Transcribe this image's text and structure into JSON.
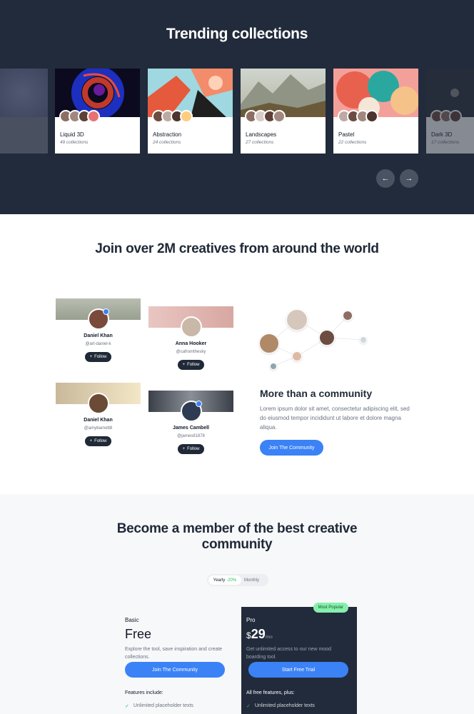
{
  "trending": {
    "title": "Trending collections",
    "collections": [
      {
        "name": "Liquid 3D",
        "count": "49 collections"
      },
      {
        "name": "Abstraction",
        "count": "24 collections"
      },
      {
        "name": "Landscapes",
        "count": "27 collections"
      },
      {
        "name": "Pastel",
        "count": "22 collections"
      },
      {
        "name": "Dark 3D",
        "count": "17 collections"
      }
    ],
    "prev_icon": "arrow-left-icon",
    "next_icon": "arrow-right-icon"
  },
  "community": {
    "title": "Join over 2M creatives from around the world",
    "users": [
      {
        "name": "Daniel Khan",
        "handle": "@art-daniel-k",
        "follow": "Follow"
      },
      {
        "name": "Anna Hooker",
        "handle": "@cafromthesky",
        "follow": "Follow"
      },
      {
        "name": "Daniel Khan",
        "handle": "@amybarnett8",
        "follow": "Follow"
      },
      {
        "name": "James Cambell",
        "handle": "@james81878",
        "follow": "Follow"
      }
    ],
    "feature_title": "More than a community",
    "feature_desc": "Lorem ipsum dolor sit amet, consectetur adipiscing elit, sed do eiusmod tempor incididunt ut labore et dolore magna aliqua.",
    "cta": "Join The Community"
  },
  "pricing": {
    "title": "Become a member of the best creative community",
    "toggle": {
      "yearly": "Yearly",
      "discount": "-20%",
      "monthly": "Monthly"
    },
    "basic": {
      "name": "Basic",
      "price": "Free",
      "desc": "Explore the tool, save inspiration and create collections.",
      "cta": "Join The Community",
      "features_heading": "Features include:",
      "features": [
        "Unlimited placeholder texts"
      ]
    },
    "pro": {
      "badge": "Most Popular",
      "name": "Pro",
      "currency": "$",
      "price": "29",
      "period": "/mo",
      "desc": "Get unlimited access to our new mood boarding tool.",
      "cta": "Start Free Trial",
      "features_heading": "All free features, plus:",
      "features": [
        "Unlimited placeholder texts"
      ]
    }
  },
  "colors": {
    "dark": "#222b3b",
    "accent": "#3b82f6",
    "success": "#22c55e"
  }
}
